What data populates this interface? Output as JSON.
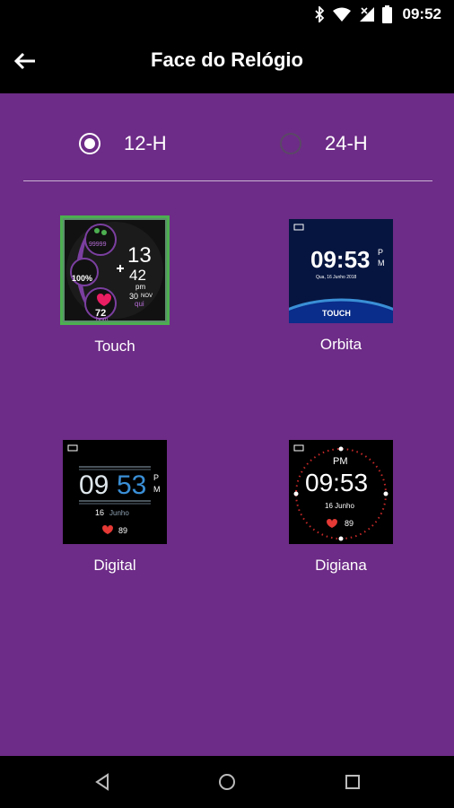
{
  "status_bar": {
    "time": "09:52",
    "icons": [
      "bluetooth-icon",
      "wifi-icon",
      "signal-icon",
      "battery-icon"
    ]
  },
  "app_bar": {
    "title": "Face do Relógio",
    "back_icon": "back-arrow-icon"
  },
  "time_format": {
    "options": [
      {
        "label": "12-H",
        "selected": true
      },
      {
        "label": "24-H",
        "selected": false
      }
    ]
  },
  "faces": [
    {
      "name": "Touch",
      "selected": true,
      "preview": {
        "steps": "99999",
        "hour": "13",
        "minute": "42",
        "ampm": "pm",
        "date_num": "30",
        "month": "NOV",
        "weekday": "qui",
        "battery": "100%",
        "heart": "72",
        "bpm": "bpm"
      }
    },
    {
      "name": "Orbita",
      "selected": false,
      "preview": {
        "time": "09:53",
        "ampm_top": "P",
        "ampm_bottom": "M",
        "date": "Qua, 16 Junho 2018",
        "brand": "TOUCH"
      }
    },
    {
      "name": "Digital",
      "selected": false,
      "preview": {
        "hour": "09",
        "minute": "53",
        "ampm_top": "P",
        "ampm_bottom": "M",
        "date_num": "16",
        "month": "Junho",
        "heart": "89"
      }
    },
    {
      "name": "Digiana",
      "selected": false,
      "preview": {
        "ampm": "PM",
        "time": "09:53",
        "date": "16 Junho",
        "heart": "89"
      }
    }
  ],
  "colors": {
    "background": "#6d2c87",
    "bars": "#000000",
    "selection_border": "#4caf50",
    "accent_blue": "#3a8fd6",
    "accent_red": "#e53935"
  },
  "nav_bar": {
    "icons": [
      "back-triangle-icon",
      "home-circle-icon",
      "recents-square-icon"
    ]
  }
}
